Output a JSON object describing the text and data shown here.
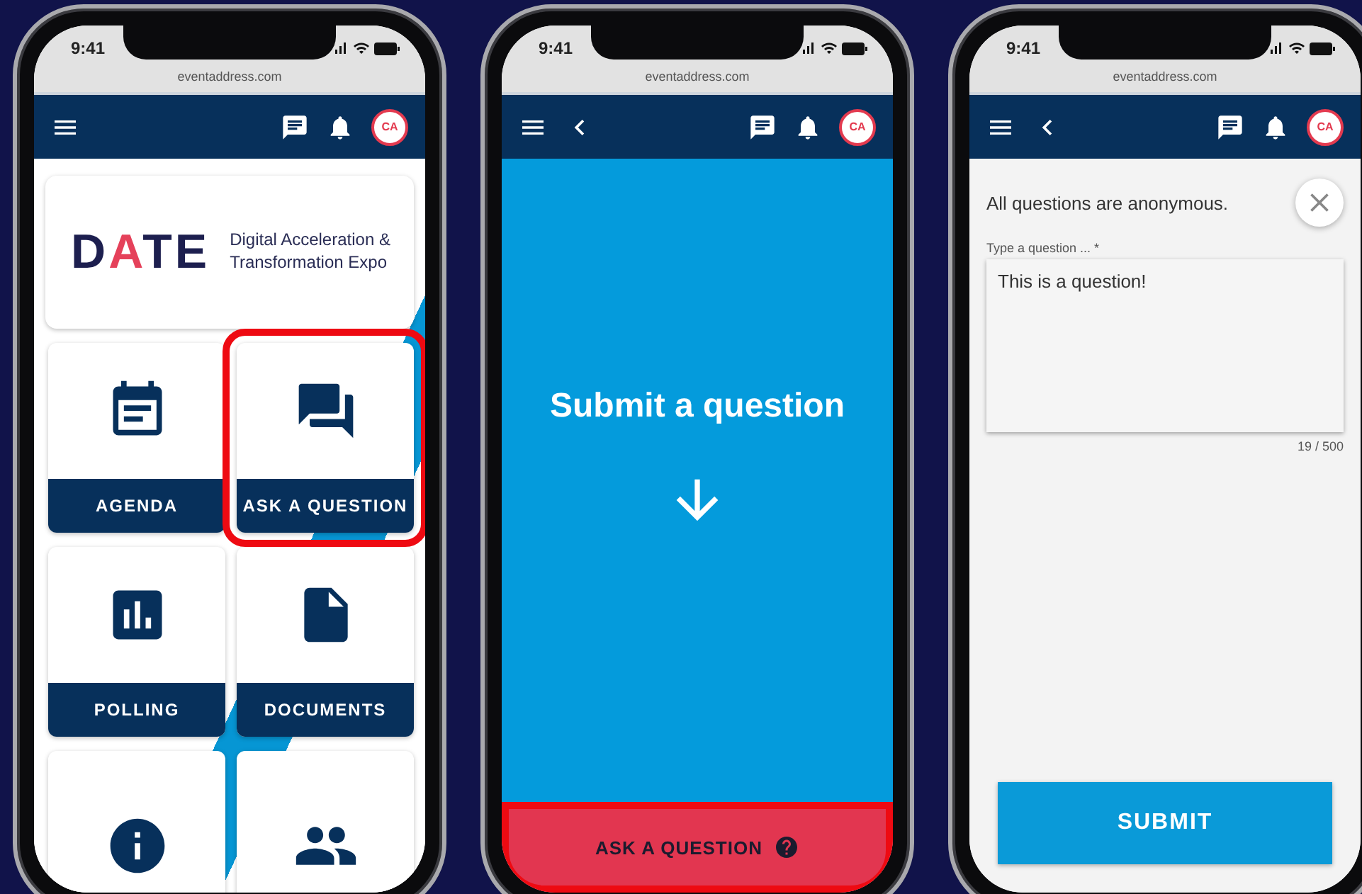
{
  "phones": [
    {
      "status": {
        "time": "9:41",
        "url": "eventaddress.com"
      },
      "app_bar": {
        "back": false,
        "avatar": "CA"
      },
      "screen": {
        "kind": "home",
        "logo": {
          "mark": "DATE",
          "tagline_1": "Digital Acceleration &",
          "tagline_2": "Transformation Expo"
        },
        "tiles": [
          {
            "label": "AGENDA",
            "highlighted": false
          },
          {
            "label": "ASK A QUESTION",
            "highlighted": true
          },
          {
            "label": "POLLING",
            "highlighted": false
          },
          {
            "label": "DOCUMENTS",
            "highlighted": false
          },
          {
            "highlighted": false
          },
          {
            "highlighted": false
          }
        ]
      }
    },
    {
      "status": {
        "time": "9:41",
        "url": "eventaddress.com"
      },
      "app_bar": {
        "back": true,
        "avatar": "CA"
      },
      "screen": {
        "kind": "intro",
        "title": "Submit a question",
        "button": {
          "label": "ASK A QUESTION",
          "highlighted": true
        }
      }
    },
    {
      "status": {
        "time": "9:41",
        "url": "eventaddress.com"
      },
      "app_bar": {
        "back": true,
        "avatar": "CA"
      },
      "screen": {
        "kind": "form",
        "notice": "All questions are anonymous.",
        "field_label": "Type a question ... *",
        "value": "This is a question!",
        "counter": "19 / 500",
        "submit": "SUBMIT"
      }
    }
  ]
}
